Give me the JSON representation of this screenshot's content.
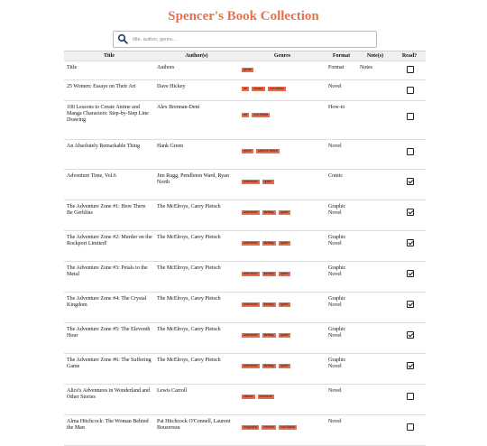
{
  "page_title": "Spencer's Book Collection",
  "search": {
    "placeholder": "title, author, genre..."
  },
  "columns": [
    "Title",
    "Author(s)",
    "Genres",
    "Format",
    "Note(s)",
    "Read?"
  ],
  "books": [
    {
      "title": "Title",
      "authors": "Authors",
      "genres": [
        "genre"
      ],
      "format": "Format",
      "notes": "Notes",
      "read": false
    },
    {
      "title": "25 Women: Essays on Their Art",
      "authors": "Dave Hickey",
      "genres": [
        "art",
        "essays",
        "non-fiction"
      ],
      "format": "Novel",
      "notes": "",
      "read": false
    },
    {
      "title": "100 Lessons to Create Anime and Manga Characters: Step-by-Step Line Drawing",
      "authors": "Alex Brennan-Dent",
      "genres": [
        "art",
        "non-fiction"
      ],
      "format": "How-to",
      "notes": "",
      "read": false
    },
    {
      "title": "An Absolutely Remarkable Thing",
      "authors": "Hank Green",
      "genres": [
        "queer",
        "science fiction"
      ],
      "format": "Novel",
      "notes": "",
      "read": false
    },
    {
      "title": "Adventure Time, Vol.6",
      "authors": "Jim Rugg, Pendleton Ward, Ryan North",
      "genres": [
        "adventure",
        "queer"
      ],
      "format": "Comic",
      "notes": "",
      "read": true
    },
    {
      "title": "The Adventure Zone #1: Here There Be Gerblins",
      "authors": "The McElroys, Carey Pietsch",
      "genres": [
        "adventure",
        "fantasy",
        "queer"
      ],
      "format": "Graphic Novel",
      "notes": "",
      "read": true
    },
    {
      "title": "The Adventure Zone #2: Murder on the Rockport Limited!",
      "authors": "The McElroys, Carey Pietsch",
      "genres": [
        "adventure",
        "fantasy",
        "queer"
      ],
      "format": "Graphic Novel",
      "notes": "",
      "read": true
    },
    {
      "title": "The Adventure Zone #3: Petals to the Metal",
      "authors": "The McElroys, Carey Pietsch",
      "genres": [
        "adventure",
        "fantasy",
        "queer"
      ],
      "format": "Graphic Novel",
      "notes": "",
      "read": true
    },
    {
      "title": "The Adventure Zone #4: The Crystal Kingdom",
      "authors": "The McElroys, Carey Pietsch",
      "genres": [
        "adventure",
        "fantasy",
        "queer"
      ],
      "format": "Graphic Novel",
      "notes": "",
      "read": true
    },
    {
      "title": "The Adventure Zone #5: The Eleventh Hour",
      "authors": "The McElroys, Carey Pietsch",
      "genres": [
        "adventure",
        "fantasy",
        "queer"
      ],
      "format": "Graphic Novel",
      "notes": "",
      "read": true
    },
    {
      "title": "The Adventure Zone #6: The Suffering Game",
      "authors": "The McElroys, Carey Pietsch",
      "genres": [
        "adventure",
        "fantasy",
        "queer"
      ],
      "format": "Graphic Novel",
      "notes": "",
      "read": true
    },
    {
      "title": "Alice's Adventures in Wonderland and Other Stories",
      "authors": "Lewis Carroll",
      "genres": [
        "classic",
        "childrens"
      ],
      "format": "Novel",
      "notes": "",
      "read": false
    },
    {
      "title": "Alma Hitchcock: The Woman Behind the Man",
      "authors": "Pat Hitchcock O'Connell, Laurent Bouzereau",
      "genres": [
        "biography",
        "memoir",
        "non-fiction"
      ],
      "format": "Novel",
      "notes": "",
      "read": false
    }
  ],
  "colors": {
    "title": "#e8704f",
    "tag": "#ea6a4a",
    "header_bg": "#efefef"
  },
  "icons": {
    "search": "search-icon"
  }
}
